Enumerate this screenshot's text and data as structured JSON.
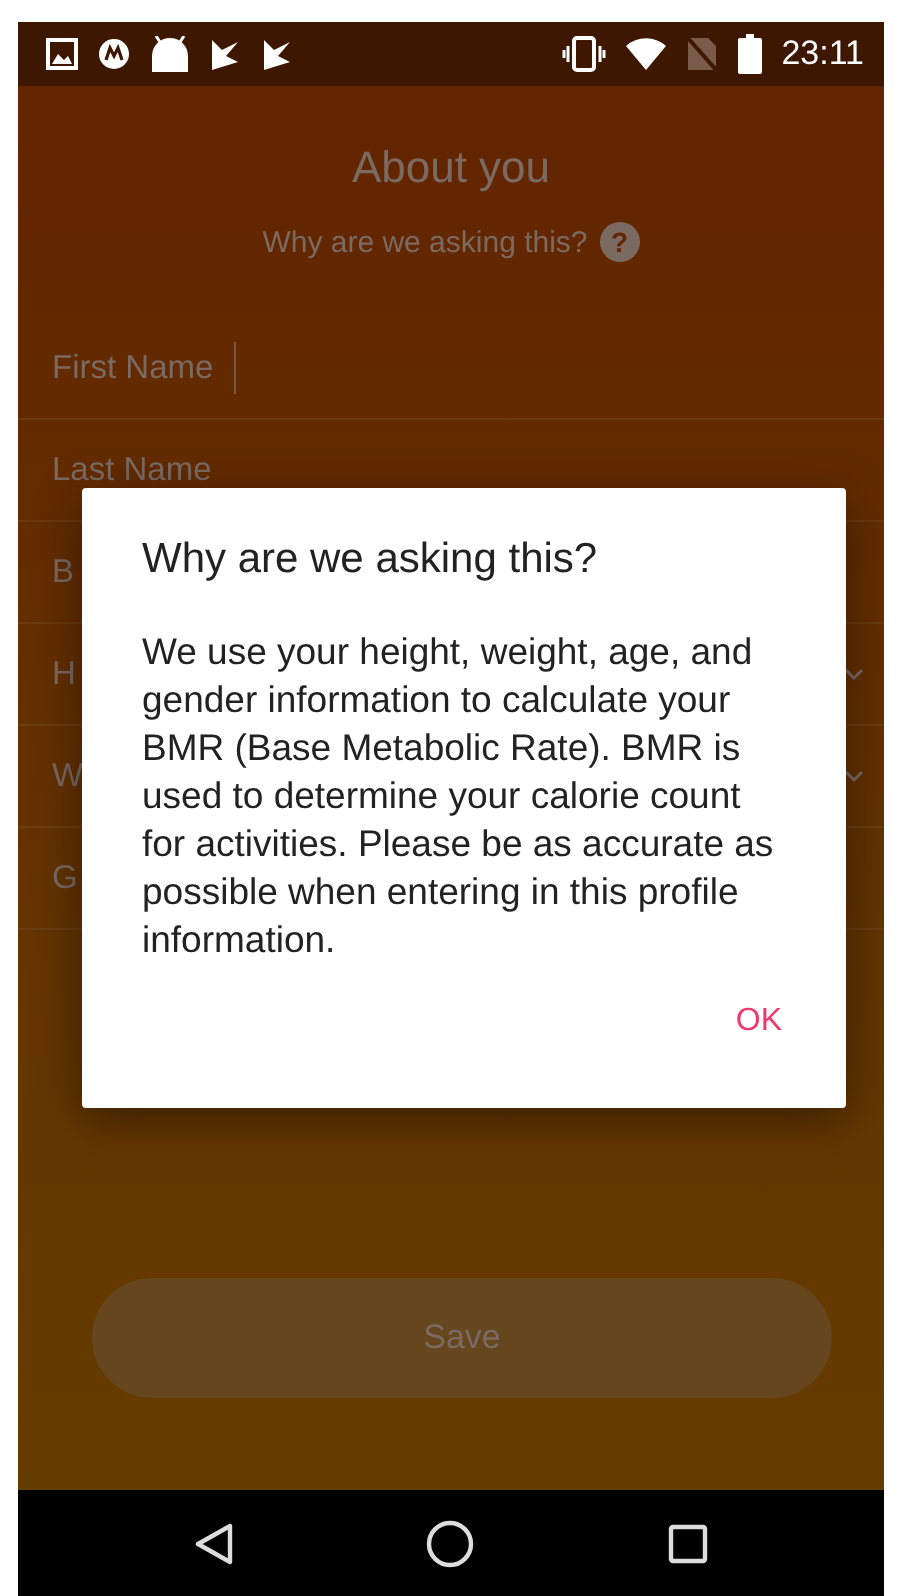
{
  "status_bar": {
    "time": "23:11"
  },
  "header": {
    "title": "About you",
    "subtitle": "Why are we asking this?",
    "help_icon": "?"
  },
  "form_fields": [
    {
      "label": "First Name",
      "kind": "text",
      "focused": true
    },
    {
      "label": "Last Name",
      "kind": "text",
      "focused": false
    },
    {
      "label": "B",
      "kind": "text"
    },
    {
      "label": "H",
      "kind": "dropdown"
    },
    {
      "label": "W",
      "kind": "dropdown"
    },
    {
      "label": "G",
      "kind": "text"
    }
  ],
  "save_button": {
    "label": "Save",
    "disabled": true
  },
  "dialog": {
    "title": "Why are we asking this?",
    "body": "We use your height, weight, age, and gender information to calculate your BMR (Base Metabolic Rate). BMR is used to determine your calorie count for activities. Please be as accurate as possible when entering in this profile information.",
    "ok_button": "OK"
  }
}
